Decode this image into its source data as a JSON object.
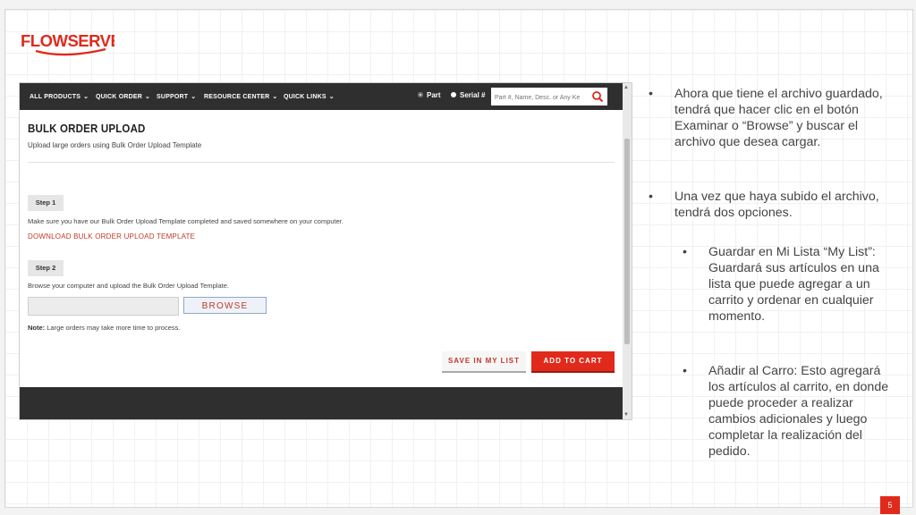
{
  "brand": {
    "logo_text": "FLOWSERVE",
    "accent": "#e02a1c",
    "dark": "#2f2f2f"
  },
  "nav": {
    "items": [
      "ALL PRODUCTS",
      "QUICK ORDER",
      "SUPPORT",
      "RESOURCE CENTER",
      "QUICK LINKS"
    ],
    "radio_part": "Part",
    "radio_serial": "Serial #",
    "search_placeholder": "Part #, Name, Desc. or Any Ke"
  },
  "page": {
    "title": "BULK ORDER UPLOAD",
    "subtitle": "Upload large orders using Bulk Order Upload Template",
    "step1_label": "Step 1",
    "step1_text": "Make sure you have our Bulk Order Upload Template completed and saved somewhere on your computer.",
    "download_link": "DOWNLOAD BULK ORDER UPLOAD TEMPLATE",
    "step2_label": "Step 2",
    "step2_text": "Browse your computer and upload the Bulk Order Upload Template.",
    "browse_label": "BROWSE",
    "note_label": "Note:",
    "note_text": " Large orders may take more time to process.",
    "save_label": "SAVE IN MY LIST",
    "cart_label": "ADD TO CART"
  },
  "bullets": [
    "Ahora que tiene el archivo guardado, tendrá que hacer clic en el botón Examinar o “Browse” y buscar el archivo que desea cargar.",
    "Una vez que haya subido el archivo, tendrá dos opciones.",
    "Guardar en Mi Lista “My List”: Guardará sus artículos en una lista que puede agregar a un carrito y ordenar en cualquier momento.",
    "Añadir al Carro: Esto agregará los artículos al carrito, en donde puede proceder a realizar cambios adicionales y luego completar la realización del pedido."
  ],
  "bullet_symbol": "•",
  "slide_number": "5"
}
